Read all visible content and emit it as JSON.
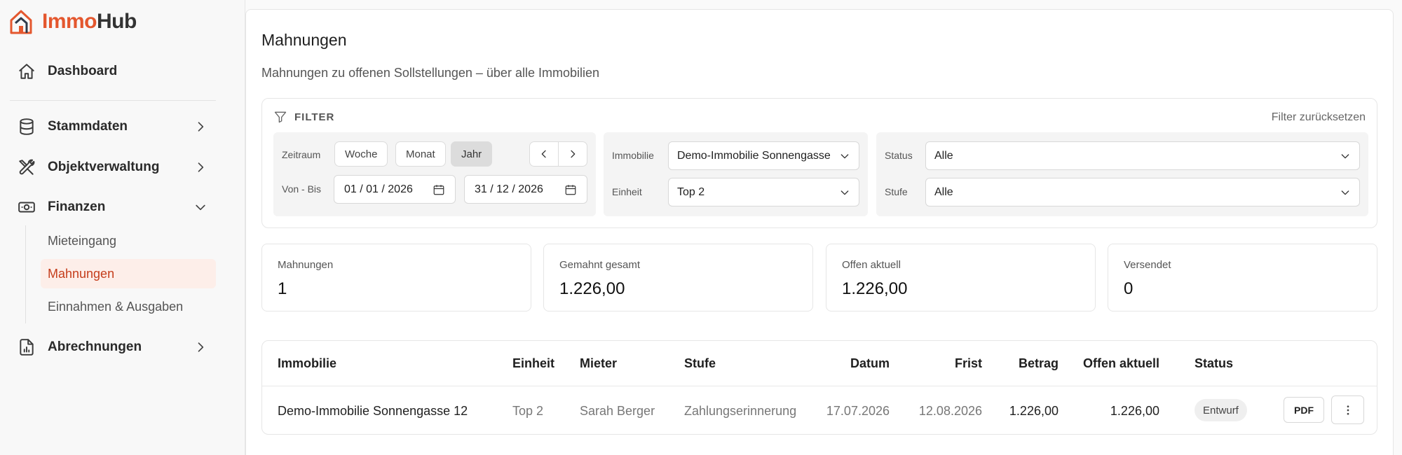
{
  "brand": {
    "part1": "Immo",
    "part2": "Hub"
  },
  "colors": {
    "accent": "#e4572e",
    "active_bg": "#fdeee9",
    "active_text": "#c53d1b"
  },
  "sidebar": {
    "dashboard": "Dashboard",
    "stammdaten": "Stammdaten",
    "objektverwaltung": "Objektverwaltung",
    "finanzen": "Finanzen",
    "finanzen_items": [
      "Mieteingang",
      "Mahnungen",
      "Einnahmen & Ausgaben"
    ],
    "abrechnungen": "Abrechnungen"
  },
  "page": {
    "title": "Mahnungen",
    "subtitle": "Mahnungen zu offenen Sollstellungen – über alle Immobilien"
  },
  "filter": {
    "heading": "FILTER",
    "reset": "Filter zurücksetzen",
    "zeitraum_label": "Zeitraum",
    "periods": [
      "Woche",
      "Monat",
      "Jahr"
    ],
    "active_period": "Jahr",
    "vonbis_label": "Von - Bis",
    "date_from": "01 / 01 / 2026",
    "date_to": "31 / 12 / 2026",
    "immobilie_label": "Immobilie",
    "immobilie_value": "Demo-Immobilie Sonnengasse 12",
    "einheit_label": "Einheit",
    "einheit_value": "Top 2",
    "status_label": "Status",
    "status_value": "Alle",
    "stufe_label": "Stufe",
    "stufe_value": "Alle"
  },
  "stats": [
    {
      "label": "Mahnungen",
      "value": "1"
    },
    {
      "label": "Gemahnt gesamt",
      "value": "1.226,00"
    },
    {
      "label": "Offen aktuell",
      "value": "1.226,00"
    },
    {
      "label": "Versendet",
      "value": "0"
    }
  ],
  "table": {
    "headers": [
      "Immobilie",
      "Einheit",
      "Mieter",
      "Stufe",
      "Datum",
      "Frist",
      "Betrag",
      "Offen aktuell",
      "Status"
    ],
    "rows": [
      {
        "immobilie": "Demo-Immobilie Sonnengasse 12",
        "einheit": "Top 2",
        "mieter": "Sarah Berger",
        "stufe": "Zahlungserinnerung",
        "datum": "17.07.2026",
        "frist": "12.08.2026",
        "betrag": "1.226,00",
        "offen": "1.226,00",
        "status": "Entwurf",
        "pdf": "PDF"
      }
    ]
  }
}
